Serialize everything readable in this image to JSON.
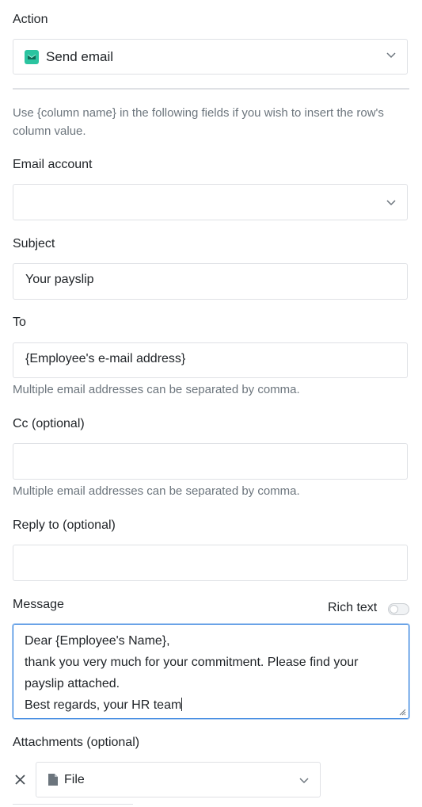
{
  "action": {
    "label": "Action",
    "selected": "Send email",
    "icon": "email-icon",
    "icon_color": "#2bc4a0"
  },
  "info": {
    "text_line1": "Use {column name} in the following fields if you wish to insert the row's",
    "text_line2": "column value."
  },
  "email_account": {
    "label": "Email account",
    "value": ""
  },
  "subject": {
    "label": "Subject",
    "value": "Your payslip"
  },
  "to": {
    "label": "To",
    "value": "{Employee's e-mail address}",
    "hint": "Multiple email addresses can be separated by comma."
  },
  "cc": {
    "label": "Cc (optional)",
    "value": "",
    "hint": "Multiple email addresses can be separated by comma."
  },
  "reply_to": {
    "label": "Reply to (optional)",
    "value": ""
  },
  "message": {
    "label": "Message",
    "rich_text_label": "Rich text",
    "rich_text_enabled": false,
    "lines": [
      "Dear {Employee's Name},",
      "thank you very much for your commitment. Please find your",
      "payslip attached.",
      "Best regards, your HR team"
    ]
  },
  "attachments": {
    "label": "Attachments (optional)",
    "items": [
      {
        "type_icon": "file-icon",
        "value": "File"
      }
    ]
  },
  "colors": {
    "focus_border": "#2f7fde",
    "border": "#dfe1e5",
    "hint": "#6c757d"
  }
}
